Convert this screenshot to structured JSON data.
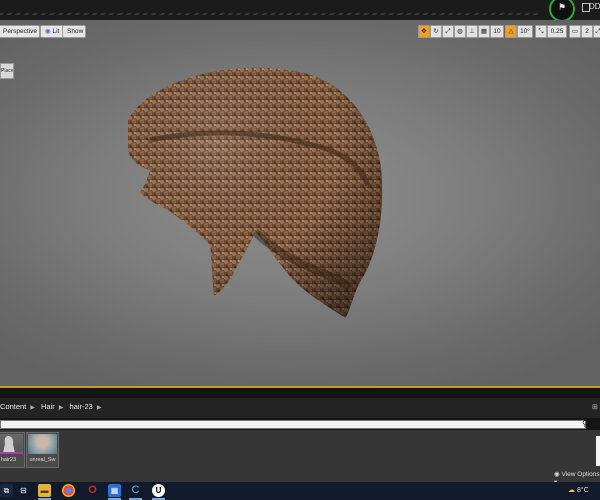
{
  "viewport": {
    "buttons": {
      "perspective": "Perspective",
      "lit": "Lit",
      "show": "Show"
    },
    "toolbar": {
      "grid_snap": "10",
      "rotate_snap": "10°",
      "scale_snap": "0.25",
      "camera_speed": "2"
    },
    "left_tab": "Placed",
    "accent_color": "#c79a2a"
  },
  "window": {
    "top_right_label": "DD"
  },
  "content_browser": {
    "breadcrumb": [
      "Content",
      "Hair",
      "hair-23"
    ],
    "assets": [
      {
        "label": "hair23"
      },
      {
        "label": "unreal_Sw"
      }
    ],
    "view_options": "View Options"
  },
  "taskbar": {
    "weather": "8°C",
    "apps": [
      "windows-icon",
      "task-view-icon",
      "file-explorer-icon",
      "chrome-icon",
      "opera-icon",
      "windows-store-icon",
      "maya-icon",
      "cinema-icon",
      "unreal-icon"
    ]
  }
}
